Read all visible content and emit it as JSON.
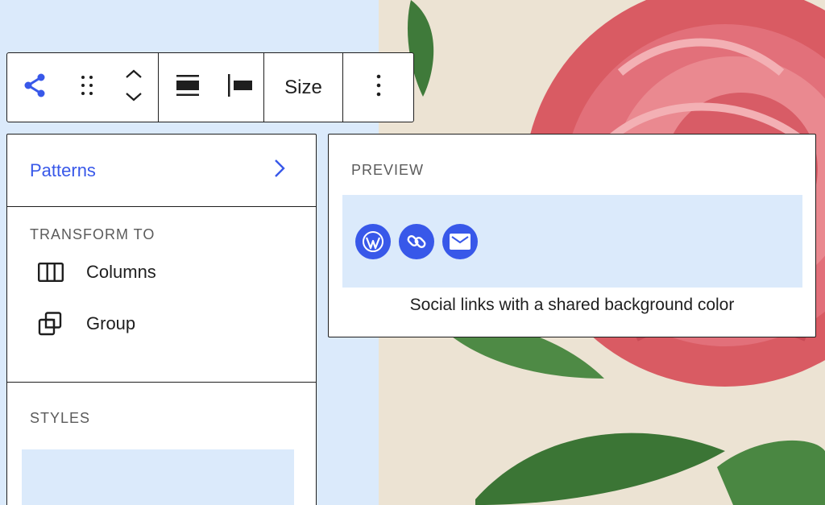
{
  "toolbar": {
    "size_label": "Size",
    "icons": [
      "share-icon",
      "drag-handle-icon",
      "move-up-down-icon",
      "justify-icon",
      "align-left-icon",
      "more-options-icon"
    ]
  },
  "panel": {
    "patterns_label": "Patterns",
    "transform_title": "TRANSFORM TO",
    "transform_items": [
      {
        "label": "Columns",
        "icon": "columns-icon"
      },
      {
        "label": "Group",
        "icon": "group-icon"
      }
    ],
    "styles_title": "STYLES"
  },
  "preview": {
    "title": "PREVIEW",
    "caption": "Social links with a shared background color",
    "social_icons": [
      "wordpress-icon",
      "link-icon",
      "mail-icon"
    ]
  },
  "colors": {
    "accent": "#3858e9",
    "preview_bg": "#dbeafb",
    "border": "#1e1e1e"
  }
}
